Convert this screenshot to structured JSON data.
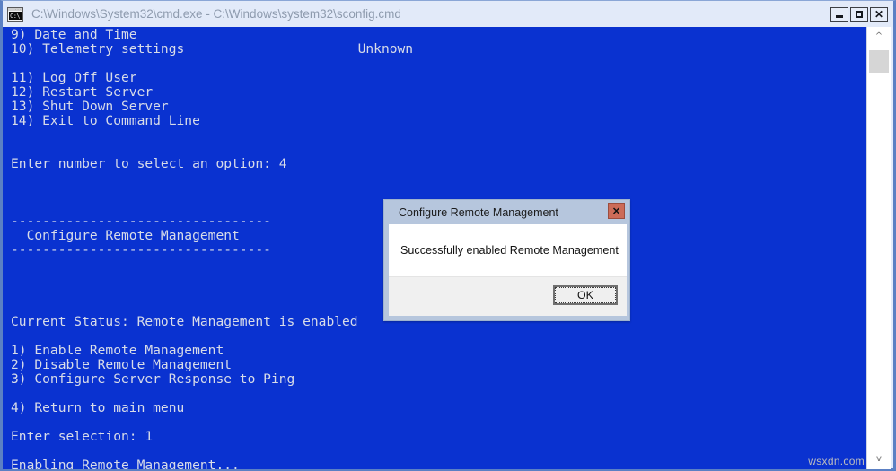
{
  "window": {
    "title": "C:\\Windows\\System32\\cmd.exe - C:\\Windows\\system32\\sconfig.cmd",
    "icon": "console-cmd-icon",
    "icon_text": "C:\\",
    "controls": {
      "minimize": "minimize-icon",
      "maximize": "maximize-icon",
      "close": "✕"
    },
    "frame_color": "#5b80c4",
    "titlebar_color": "#e2eaf9",
    "title_text_color": "#8e9bae"
  },
  "console": {
    "background": "#0a32d0",
    "foreground": "#d8dce8",
    "lines": [
      "9) Date and Time",
      "10) Telemetry settings                      Unknown",
      "",
      "11) Log Off User",
      "12) Restart Server",
      "13) Shut Down Server",
      "14) Exit to Command Line",
      "",
      "",
      "Enter number to select an option: 4",
      "",
      "",
      "",
      "---------------------------------",
      "  Configure Remote Management",
      "---------------------------------",
      "",
      "",
      "",
      "",
      "Current Status: Remote Management is enabled",
      "",
      "1) Enable Remote Management",
      "2) Disable Remote Management",
      "3) Configure Server Response to Ping",
      "",
      "4) Return to main menu",
      "",
      "Enter selection: 1",
      "",
      "Enabling Remote Management..."
    ]
  },
  "scrollbar": {
    "up_arrow": "^",
    "down_arrow": "v",
    "thumb": "scroll-thumb"
  },
  "dialog": {
    "title": "Configure Remote Management",
    "close_label": "✕",
    "close_color": "#cc6b58",
    "message": "Successfully enabled Remote Management",
    "ok_label": "OK",
    "border_color": "#b6c6dd",
    "body_color": "#ffffff",
    "footer_color": "#f0f0f0"
  },
  "watermark": {
    "text": "wsxdn.com"
  }
}
